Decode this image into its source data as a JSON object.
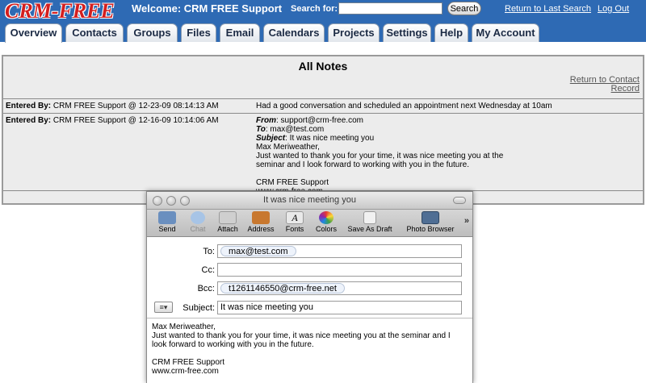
{
  "header": {
    "logo": "CRM-FREE",
    "welcome": "Welcome: CRM FREE Support",
    "search_label": "Search for:",
    "search_value": "",
    "search_button": "Search",
    "return_last_search": "Return to Last Search",
    "logout": "Log Out"
  },
  "tabs": [
    "Overview",
    "Contacts",
    "Groups",
    "Files",
    "Email",
    "Calendars",
    "Projects",
    "Settings",
    "Help",
    "My Account"
  ],
  "notes": {
    "title": "All Notes",
    "return_contact": "Return to Contact Record",
    "entered_label": "Entered By:",
    "rows": [
      {
        "entered": "CRM FREE Support @ 12-23-09 08:14:13 AM",
        "text": "Had a good conversation and scheduled an appointment next Wednesday at 10am"
      },
      {
        "entered": "CRM FREE Support @ 12-16-09 10:14:06 AM",
        "from_label": "From",
        "from": ": support@crm-free.com",
        "to_label": "To",
        "to": ": max@test.com",
        "subject_label": "Subject",
        "subject": ": It was nice meeting you",
        "body": "Max Meriweather,\nJust wanted to thank you for your time, it was nice meeting you at the\nseminar and I look forward to working with you in the future.\n\nCRM FREE Support\nwww.crm-free.com"
      }
    ]
  },
  "mail": {
    "title": "It was nice meeting you",
    "toolbar": [
      {
        "label": "Send",
        "icon": "send-icon",
        "color": "#6a8fbf"
      },
      {
        "label": "Chat",
        "icon": "chat-icon",
        "color": "#a7c4e6",
        "disabled": true
      },
      {
        "label": "Attach",
        "icon": "paperclip-icon",
        "color": "#9a9a9a"
      },
      {
        "label": "Address",
        "icon": "address-book-icon",
        "color": "#c8782f"
      },
      {
        "label": "Fonts",
        "icon": "fonts-icon",
        "color": "#e9e9e9"
      },
      {
        "label": "Colors",
        "icon": "color-wheel-icon",
        "color": "#d44fbf"
      },
      {
        "label": "Save As Draft",
        "icon": "draft-icon",
        "color": "#f1f1f1"
      },
      {
        "label": "Photo Browser",
        "icon": "photo-browser-icon",
        "color": "#4f6e94"
      }
    ],
    "to_label": "To:",
    "to": "max@test.com",
    "cc_label": "Cc:",
    "cc": "",
    "bcc_label": "Bcc:",
    "bcc": "t1261146550@crm-free.net",
    "subject_label": "Subject:",
    "subject": "It was nice meeting you",
    "body": "Max Meriweather,\nJust wanted to thank you for your time, it was nice meeting you at the seminar and I\nlook forward to working with you in the future.\n\nCRM FREE Support\nwww.crm-free.com"
  }
}
